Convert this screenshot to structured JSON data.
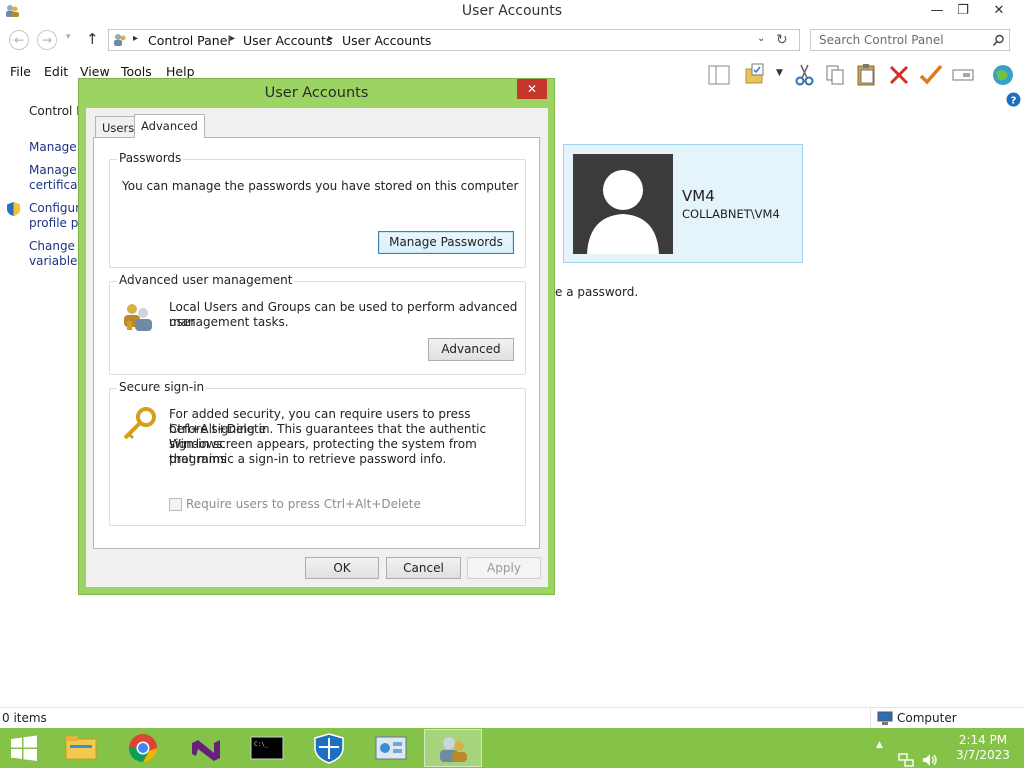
{
  "window": {
    "title": "User Accounts"
  },
  "address": {
    "crumbs": [
      "Control Panel",
      "User Accounts",
      "User Accounts"
    ],
    "search_placeholder": "Search Control Panel"
  },
  "menu": [
    "File",
    "Edit",
    "View",
    "Tools",
    "Help"
  ],
  "left_pane": {
    "home": "Control P",
    "links": [
      "Manage y",
      "Manage y",
      "certificate",
      "Configure",
      "profile pr",
      "Change n",
      "variables"
    ]
  },
  "user": {
    "name": "VM4",
    "domain": "COLLABNET\\VM4"
  },
  "background_text": "e a password.",
  "dialog": {
    "title": "User Accounts",
    "close_glyph": "✕",
    "tabs": [
      "Users",
      "Advanced"
    ],
    "passwords": {
      "label": "Passwords",
      "text": "You can manage the passwords you have stored on this computer",
      "button": "Manage Passwords"
    },
    "advanced_mgmt": {
      "label": "Advanced user management",
      "text_line1": "Local Users and Groups can be used to perform advanced user",
      "text_line2": "management tasks.",
      "button": "Advanced"
    },
    "secure_signin": {
      "label": "Secure sign-in",
      "text_line1": "For added security, you can require users to press Ctrl+Alt+Delete",
      "text_line2": "before signing in. This guarantees that the authentic Windows",
      "text_line3": "sign-in screen appears, protecting the system from programs",
      "text_line4": "that mimic a sign-in to retrieve password info.",
      "checkbox_label": "Require users to press Ctrl+Alt+Delete",
      "checkbox_checked": false
    },
    "buttons": {
      "ok": "OK",
      "cancel": "Cancel",
      "apply": "Apply"
    }
  },
  "status": {
    "items": "0 items",
    "zone": "Computer"
  },
  "taskbar": {
    "apps": [
      "file-explorer-icon",
      "chrome-icon",
      "visual-studio-icon",
      "command-prompt-icon",
      "windows-defender-icon",
      "control-panel-icon",
      "user-accounts-icon"
    ],
    "time": "2:14 PM",
    "date": "3/7/2023"
  },
  "colors": {
    "accent": "#9cd463",
    "taskbar": "#84c248",
    "close": "#c7362b",
    "tile": "#e5f3fb"
  }
}
